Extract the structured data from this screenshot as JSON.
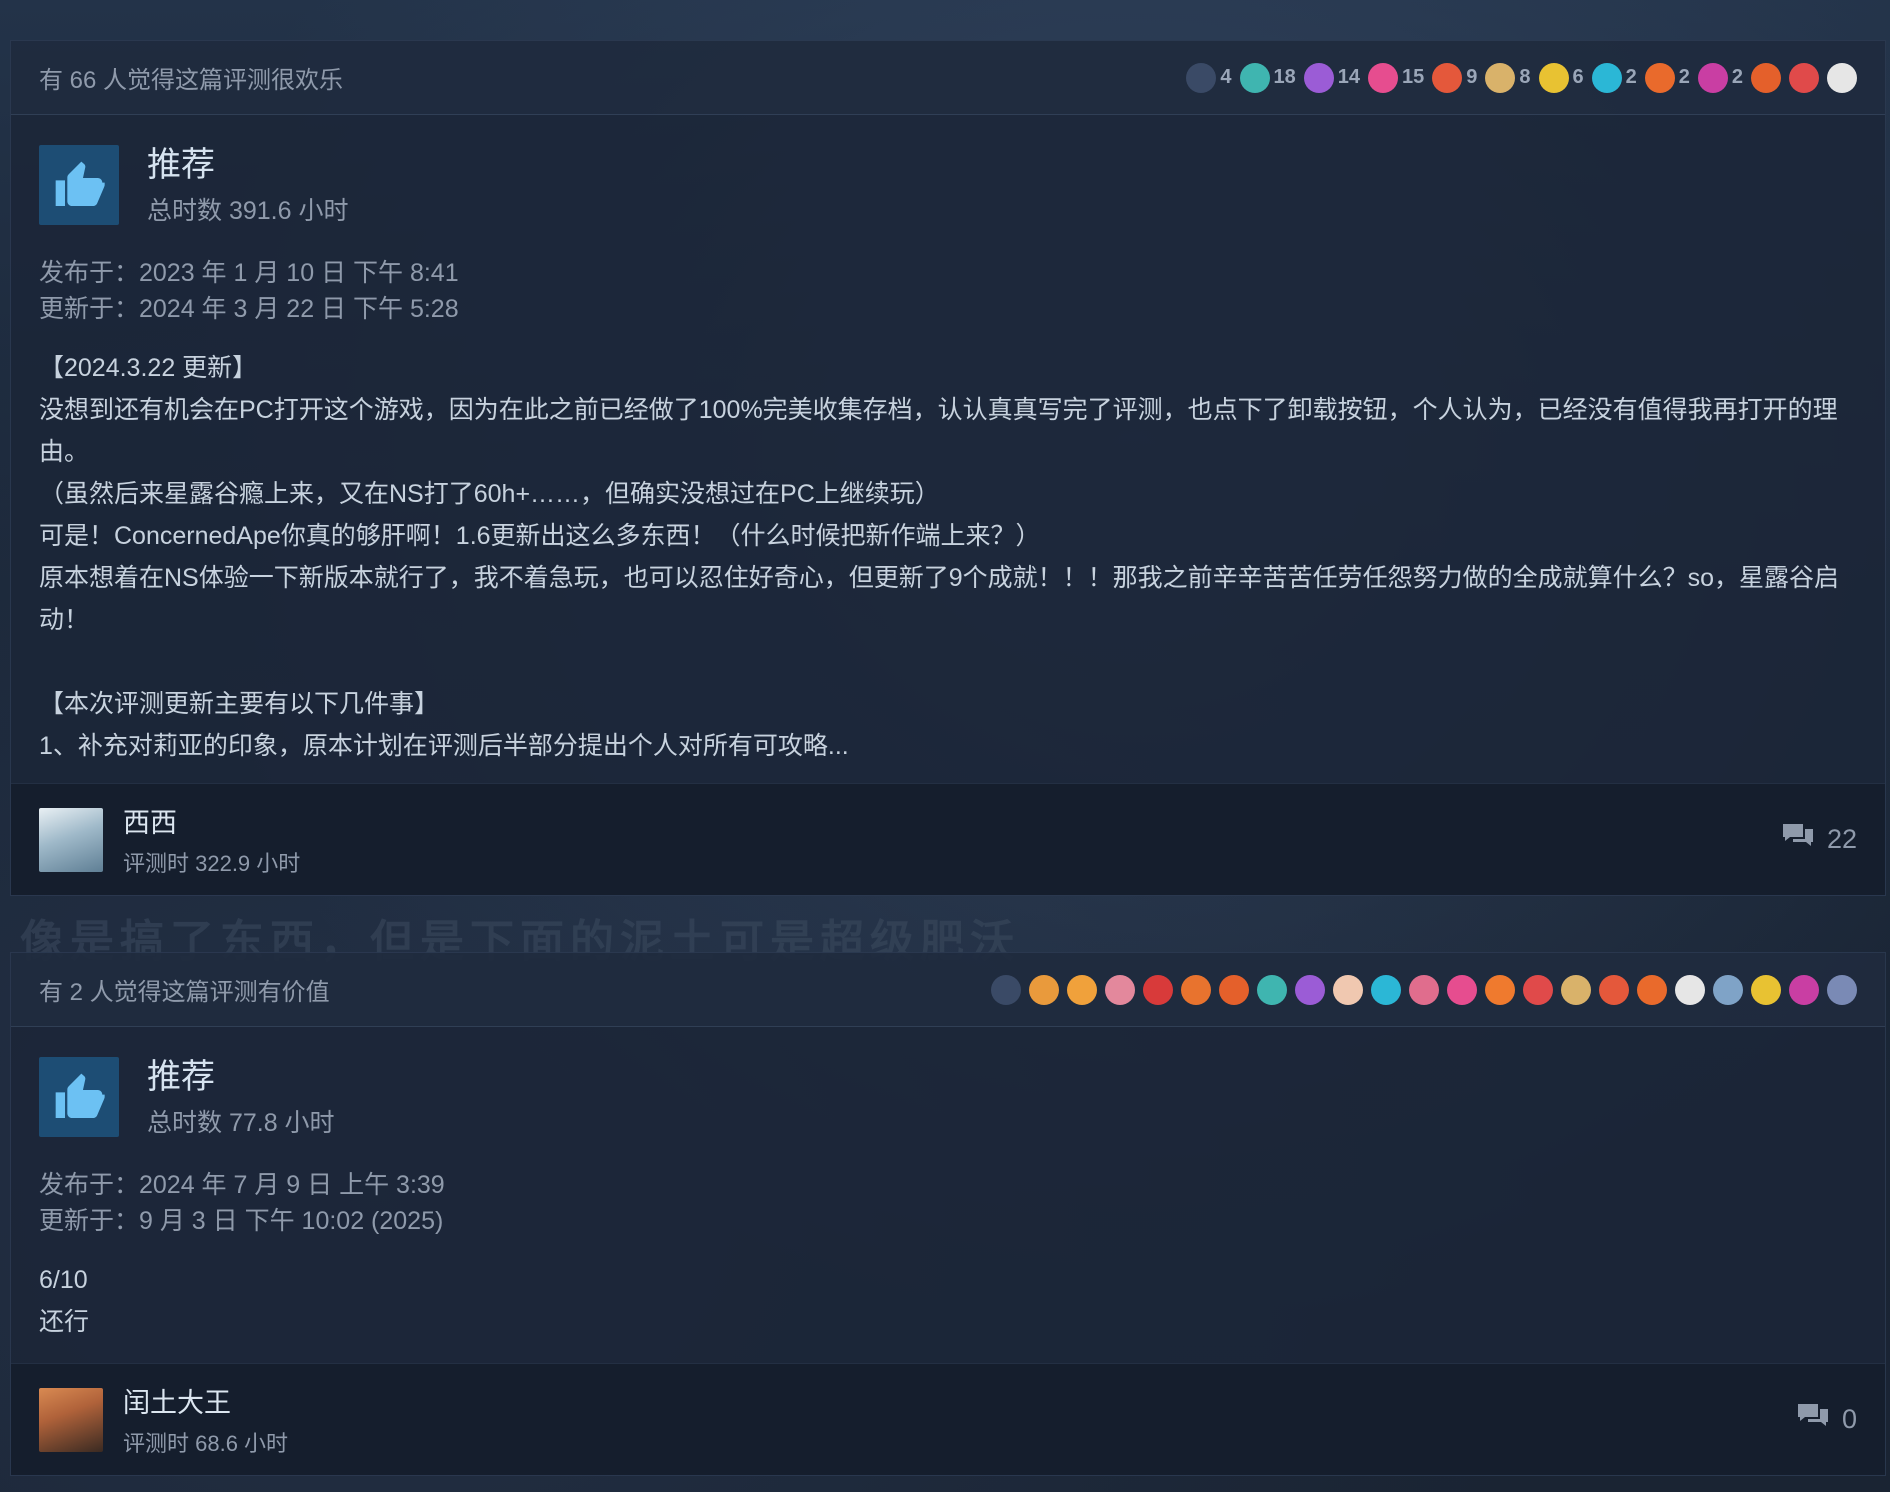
{
  "background_hint": "像是搞了东西，但是下面的泥土可是超级肥沃",
  "reviews": [
    {
      "helpful_text": "有 66 人觉得这篇评测很欢乐",
      "awards": [
        {
          "icon": "yurt-icon",
          "count": "4",
          "color": "#3a4a66"
        },
        {
          "icon": "slime-icon",
          "count": "18",
          "color": "#3fb5b0"
        },
        {
          "icon": "purple-hands-icon",
          "count": "14",
          "color": "#9b5cd6"
        },
        {
          "icon": "heart-icon",
          "count": "15",
          "color": "#e64d8f"
        },
        {
          "icon": "candy-icon",
          "count": "9",
          "color": "#e4583b"
        },
        {
          "icon": "scroll-icon",
          "count": "8",
          "color": "#d9b26a"
        },
        {
          "icon": "sun-icon",
          "count": "6",
          "color": "#e8c232"
        },
        {
          "icon": "comet-icon",
          "count": "2",
          "color": "#2bb7d6"
        },
        {
          "icon": "party-icon",
          "count": "2",
          "color": "#e96a2c"
        },
        {
          "icon": "alien-icon",
          "count": "2",
          "color": "#c93ea3"
        },
        {
          "icon": "cannon-icon",
          "count": "",
          "color": "#e4602b"
        },
        {
          "icon": "rooster-icon",
          "count": "",
          "color": "#e04a4a"
        },
        {
          "icon": "statue-icon",
          "count": "",
          "color": "#e6e6e6"
        }
      ],
      "verdict": "推荐",
      "total_hours": "总时数 391.6 小时",
      "posted": "发布于：2023 年 1 月 10 日 下午 8:41",
      "updated": "更新于：2024 年 3 月 22 日 下午 5:28",
      "body": "【2024.3.22 更新】\n没想到还有机会在PC打开这个游戏，因为在此之前已经做了100%完美收集存档，认认真真写完了评测，也点下了卸载按钮，个人认为，已经没有值得我再打开的理由。\n（虽然后来星露谷瘾上来，又在NS打了60h+……，但确实没想过在PC上继续玩）\n可是！ConcernedApe你真的够肝啊！1.6更新出这么多东西！（什么时候把新作端上来？）\n原本想着在NS体验一下新版本就行了，我不着急玩，也可以忍住好奇心，但更新了9个成就！！！那我之前辛辛苦苦任劳任怨努力做的全成就算什么？so，星露谷启动！\n\n【本次评测更新主要有以下几件事】\n1、补充对莉亚的印象，原本计划在评测后半部分提出个人对所有可攻略...",
      "user_name": "西西",
      "user_hours": "评测时 322.9 小时",
      "comment_count": "22",
      "avatar_color": "#9fb9c9"
    },
    {
      "helpful_text": "有 2 人觉得这篇评测有价值",
      "awards": [
        {
          "icon": "yurt-icon",
          "count": "",
          "color": "#3a4a66"
        },
        {
          "icon": "fox-icon",
          "count": "",
          "color": "#e99a3c"
        },
        {
          "icon": "horn-icon",
          "count": "",
          "color": "#f0a13b"
        },
        {
          "icon": "brain-icon",
          "count": "",
          "color": "#e3889c"
        },
        {
          "icon": "soda-icon",
          "count": "",
          "color": "#d83a3a"
        },
        {
          "icon": "torch-icon",
          "count": "",
          "color": "#e8732e"
        },
        {
          "icon": "cannon-icon",
          "count": "",
          "color": "#e4602b"
        },
        {
          "icon": "slime-icon",
          "count": "",
          "color": "#3fb5b0"
        },
        {
          "icon": "purple-hands-icon",
          "count": "",
          "color": "#9b5cd6"
        },
        {
          "icon": "clown-icon",
          "count": "",
          "color": "#f0c8b0"
        },
        {
          "icon": "comet-icon",
          "count": "",
          "color": "#2bb7d6"
        },
        {
          "icon": "snail-icon",
          "count": "",
          "color": "#e06d8d"
        },
        {
          "icon": "heart-icon",
          "count": "",
          "color": "#e64d8f"
        },
        {
          "icon": "laugh-icon",
          "count": "",
          "color": "#ef7a2e"
        },
        {
          "icon": "rooster-icon",
          "count": "",
          "color": "#e04a4a"
        },
        {
          "icon": "scroll-icon",
          "count": "",
          "color": "#d9b26a"
        },
        {
          "icon": "candy-icon",
          "count": "",
          "color": "#e4583b"
        },
        {
          "icon": "party-icon",
          "count": "",
          "color": "#e96a2c"
        },
        {
          "icon": "statue-icon",
          "count": "",
          "color": "#e6e6e6"
        },
        {
          "icon": "tree-icon",
          "count": "",
          "color": "#7fa3c7"
        },
        {
          "icon": "sun-icon",
          "count": "",
          "color": "#e8c232"
        },
        {
          "icon": "alien-icon",
          "count": "",
          "color": "#c93ea3"
        },
        {
          "icon": "tiger-icon",
          "count": "",
          "color": "#7a8ab5"
        }
      ],
      "verdict": "推荐",
      "total_hours": "总时数 77.8 小时",
      "posted": "发布于：2024 年 7 月 9 日 上午 3:39",
      "updated": "更新于：9 月 3 日 下午 10:02 (2025)",
      "body": "6/10\n还行",
      "user_name": "闰土大王",
      "user_hours": "评测时 68.6 小时",
      "comment_count": "0",
      "avatar_color": "#b0623a"
    }
  ]
}
